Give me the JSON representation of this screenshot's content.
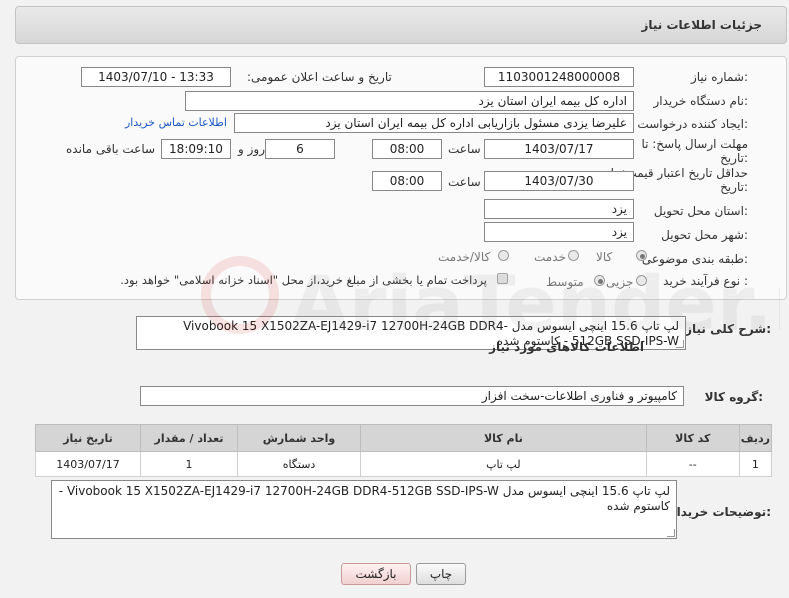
{
  "header": {
    "title": "جزئیات اطلاعات نیاز"
  },
  "form": {
    "need_number_label": "شماره نیاز:",
    "need_number": "1103001248000008",
    "announce_label": "تاریخ و ساعت اعلان عمومی:",
    "announce_value": "1403/07/10 - 13:33",
    "buyer_org_label": "نام دستگاه خریدار:",
    "buyer_org": "اداره کل بیمه ایران استان یزد",
    "creator_label": "ایجاد کننده درخواست:",
    "creator": "علیرضا یزدی مسئول بازاریابی اداره کل بیمه ایران استان یزد",
    "contact_link": "اطلاعات تماس خریدار",
    "deadline_label_line1": "مهلت ارسال پاسخ: تا",
    "deadline_label_line2": "تاریخ:",
    "deadline_date": "1403/07/17",
    "time_label": "ساعت",
    "deadline_time": "08:00",
    "days_value": "6",
    "days_label": "روز و",
    "remaining_time": "18:09:10",
    "remaining_label": "ساعت باقی مانده",
    "validity_label_line1": "حداقل تاریخ اعتبار قیمت: تا",
    "validity_label_line2": "تاریخ:",
    "validity_date": "1403/07/30",
    "validity_time": "08:00",
    "province_label": "استان محل تحویل:",
    "province": "یزد",
    "city_label": "شهر محل تحویل:",
    "city": "یزد",
    "category_label": "طبقه بندی موضوعی:",
    "category_options": [
      "کالا",
      "خدمت",
      "کالا/خدمت"
    ],
    "process_label": "نوع فرآیند خرید :",
    "process_options": [
      "جزیی",
      "متوسط"
    ],
    "payment_note": "پرداخت تمام یا بخشی از مبلغ خرید،از محل \"اسناد خزانه اسلامی\" خواهد بود."
  },
  "summary": {
    "label": "شرح کلی نیاز:",
    "text": "لپ تاپ 15.6 اینچی ایسوس مدل Vivobook 15 X1502ZA-EJ1429-i7 12700H-24GB DDR4-512GB SSD-IPS-W - کاستوم شده"
  },
  "goods": {
    "section_title": "اطلاعات کالاهای مورد نیاز",
    "group_label": "گروه کالا:",
    "group_value": "کامپیوتر و فناوری اطلاعات-سخت افزار",
    "columns": [
      "ردیف",
      "کد کالا",
      "نام کالا",
      "واحد شمارش",
      "تعداد / مقدار",
      "تاریخ نیاز"
    ],
    "rows": [
      {
        "row": "1",
        "code": "--",
        "name": "لپ تاپ",
        "unit": "دستگاه",
        "qty": "1",
        "date": "1403/07/17"
      }
    ]
  },
  "buyer_notes": {
    "label": "توضیحات خریدار:",
    "text": "لپ تاپ 15.6 اینچی ایسوس مدل Vivobook 15 X1502ZA-EJ1429-i7 12700H-24GB DDR4-512GB SSD-IPS-W - کاستوم شده"
  },
  "buttons": {
    "print": "چاپ",
    "back": "بازگشت"
  },
  "watermark": {
    "text": "AriaTender.neT"
  },
  "colors": {
    "link": "#1a58c7",
    "back_button_bg": "#f1d0d0"
  }
}
